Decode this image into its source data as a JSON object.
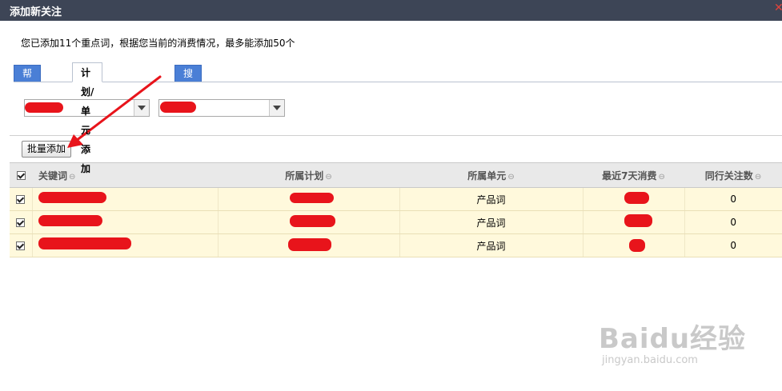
{
  "dialog": {
    "title": "添加新关注",
    "notice": "您已添加11个重点词，根据您当前的消费情况，最多能添加50个"
  },
  "tabs": [
    {
      "label": "帮你找词",
      "active": false
    },
    {
      "label": "计划/单元 添加",
      "active": true
    },
    {
      "label": "搜索添加",
      "active": false
    }
  ],
  "selects": {
    "plan": {
      "value": ""
    },
    "unit": {
      "value": ""
    }
  },
  "batch_add_label": "批量添加",
  "table": {
    "columns": [
      "关键词",
      "所属计划",
      "所属单元",
      "最近7天消费",
      "同行关注数"
    ],
    "rows": [
      {
        "checked": true,
        "keyword": "",
        "plan": "",
        "unit": "产品词",
        "cost": "",
        "followers": "0"
      },
      {
        "checked": true,
        "keyword": "",
        "plan": "",
        "unit": "产品词",
        "cost": "",
        "followers": "0"
      },
      {
        "checked": true,
        "keyword": "",
        "plan": "",
        "unit": "产品词",
        "cost": "",
        "followers": "0"
      }
    ]
  },
  "watermark": {
    "brand": "Baidu经验",
    "url": "jingyan.baidu.com"
  },
  "colors": {
    "titlebar": "#3d4556",
    "tab_inactive": "#4a7fd6",
    "row_highlight": "#fff9dc",
    "annotation_red": "#e8141b"
  }
}
